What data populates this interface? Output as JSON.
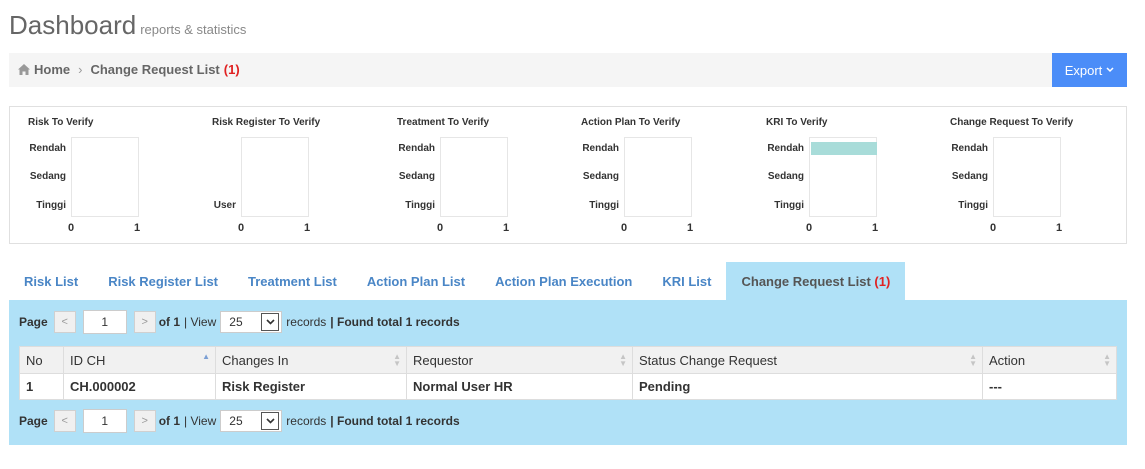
{
  "page": {
    "title": "Dashboard",
    "subtitle": "reports & statistics"
  },
  "breadcrumb": {
    "home": "Home",
    "current": "Change Request List",
    "count": "(1)"
  },
  "export_label": "Export",
  "stats": [
    {
      "title": "Risk To Verify",
      "y_labels": [
        "Rendah",
        "Sedang",
        "Tinggi"
      ],
      "x_min": "0",
      "x_max": "1"
    },
    {
      "title": "Risk Register To Verify",
      "y_labels": [
        "User"
      ],
      "x_min": "0",
      "x_max": "1"
    },
    {
      "title": "Treatment To Verify",
      "y_labels": [
        "Rendah",
        "Sedang",
        "Tinggi"
      ],
      "x_min": "0",
      "x_max": "1"
    },
    {
      "title": "Action Plan To Verify",
      "y_labels": [
        "Rendah",
        "Sedang",
        "Tinggi"
      ],
      "x_min": "0",
      "x_max": "1"
    },
    {
      "title": "KRI To Verify",
      "y_labels": [
        "Rendah",
        "Sedang",
        "Tinggi"
      ],
      "x_min": "0",
      "x_max": "1",
      "bar_value": 1,
      "bar_color": "#a8dcd9"
    },
    {
      "title": "Change Request To Verify",
      "y_labels": [
        "Rendah",
        "Sedang",
        "Tinggi"
      ],
      "x_min": "0",
      "x_max": "1"
    }
  ],
  "tabs": [
    {
      "label": "Risk List"
    },
    {
      "label": "Risk Register List"
    },
    {
      "label": "Treatment List"
    },
    {
      "label": "Action Plan List"
    },
    {
      "label": "Action Plan Execution"
    },
    {
      "label": "KRI List"
    },
    {
      "label": "Change Request List",
      "count": "(1)",
      "active": true
    }
  ],
  "pager": {
    "page_label": "Page",
    "page_value": "1",
    "of_label": "of 1",
    "view_label": "| View",
    "view_value": "25",
    "records_label": "records",
    "found_label": "| Found total 1 records"
  },
  "table": {
    "columns": [
      "No",
      "ID CH",
      "Changes In",
      "Requestor",
      "Status Change Request",
      "Action"
    ],
    "rows": [
      [
        "1",
        "CH.000002",
        "Risk Register",
        "Normal User HR",
        "Pending",
        "---"
      ]
    ]
  },
  "colors": {
    "accent": "#4b8df8",
    "tab_active": "#b0e1f7",
    "link": "#35aa47",
    "count_red": "#e02222"
  }
}
